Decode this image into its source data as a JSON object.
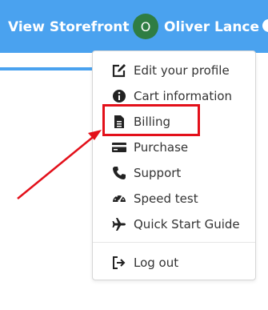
{
  "header": {
    "storefront_label": "View Storefront",
    "avatar_initial": "O",
    "user_name": "Oliver Lance"
  },
  "menu": {
    "items": [
      {
        "label": "Edit your profile",
        "icon": "edit-icon"
      },
      {
        "label": "Cart information",
        "icon": "info-icon"
      },
      {
        "label": "Billing",
        "icon": "document-icon"
      },
      {
        "label": "Purchase",
        "icon": "credit-card-icon"
      },
      {
        "label": "Support",
        "icon": "phone-icon"
      },
      {
        "label": "Speed test",
        "icon": "speedometer-icon"
      },
      {
        "label": "Quick Start Guide",
        "icon": "plane-icon"
      }
    ],
    "logout_label": "Log out"
  },
  "colors": {
    "topbar": "#4aa2ef",
    "avatar": "#2f7d43",
    "annotation": "#e3101a",
    "text": "#333333"
  }
}
